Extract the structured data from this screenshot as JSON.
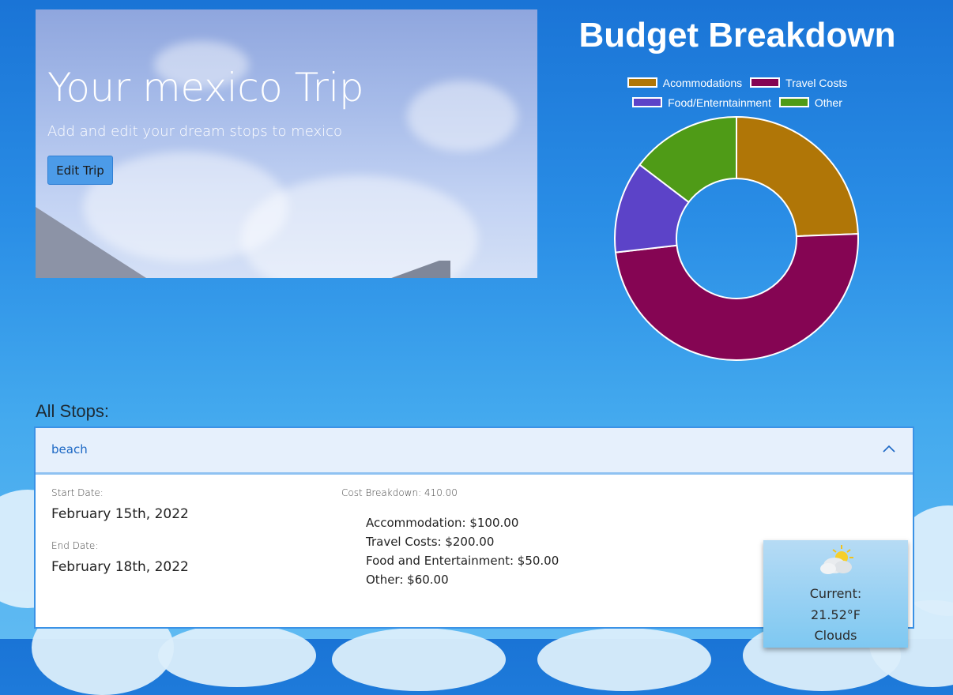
{
  "hero": {
    "title": "Your mexico Trip",
    "subtitle": "Add and edit your dream stops to mexico",
    "edit_button": "Edit Trip"
  },
  "budget": {
    "title": "Budget Breakdown"
  },
  "chart_data": {
    "type": "pie",
    "categories": [
      "Acommodations",
      "Travel Costs",
      "Food/Enterntainment",
      "Other"
    ],
    "values": [
      100,
      200,
      50,
      60
    ],
    "colors": [
      "#b07607",
      "#850553",
      "#5c43c8",
      "#4f9b17"
    ],
    "legend_position": "top",
    "donut": true
  },
  "stops": {
    "heading": "All Stops:",
    "items": [
      {
        "name": "beach",
        "start_label": "Start Date:",
        "start_date": "February 15th, 2022",
        "end_label": "End Date:",
        "end_date": "February 18th, 2022",
        "cost_label": "Cost Breakdown: 410.00",
        "costs": [
          "Accommodation: $100.00",
          "Travel Costs: $200.00",
          "Food and Entertainment: $50.00",
          "Other: $60.00"
        ],
        "weather": {
          "icon": "partly-cloudy-icon",
          "current_label": "Current:",
          "temperature": "21.52°F",
          "condition": "Clouds"
        }
      }
    ]
  }
}
